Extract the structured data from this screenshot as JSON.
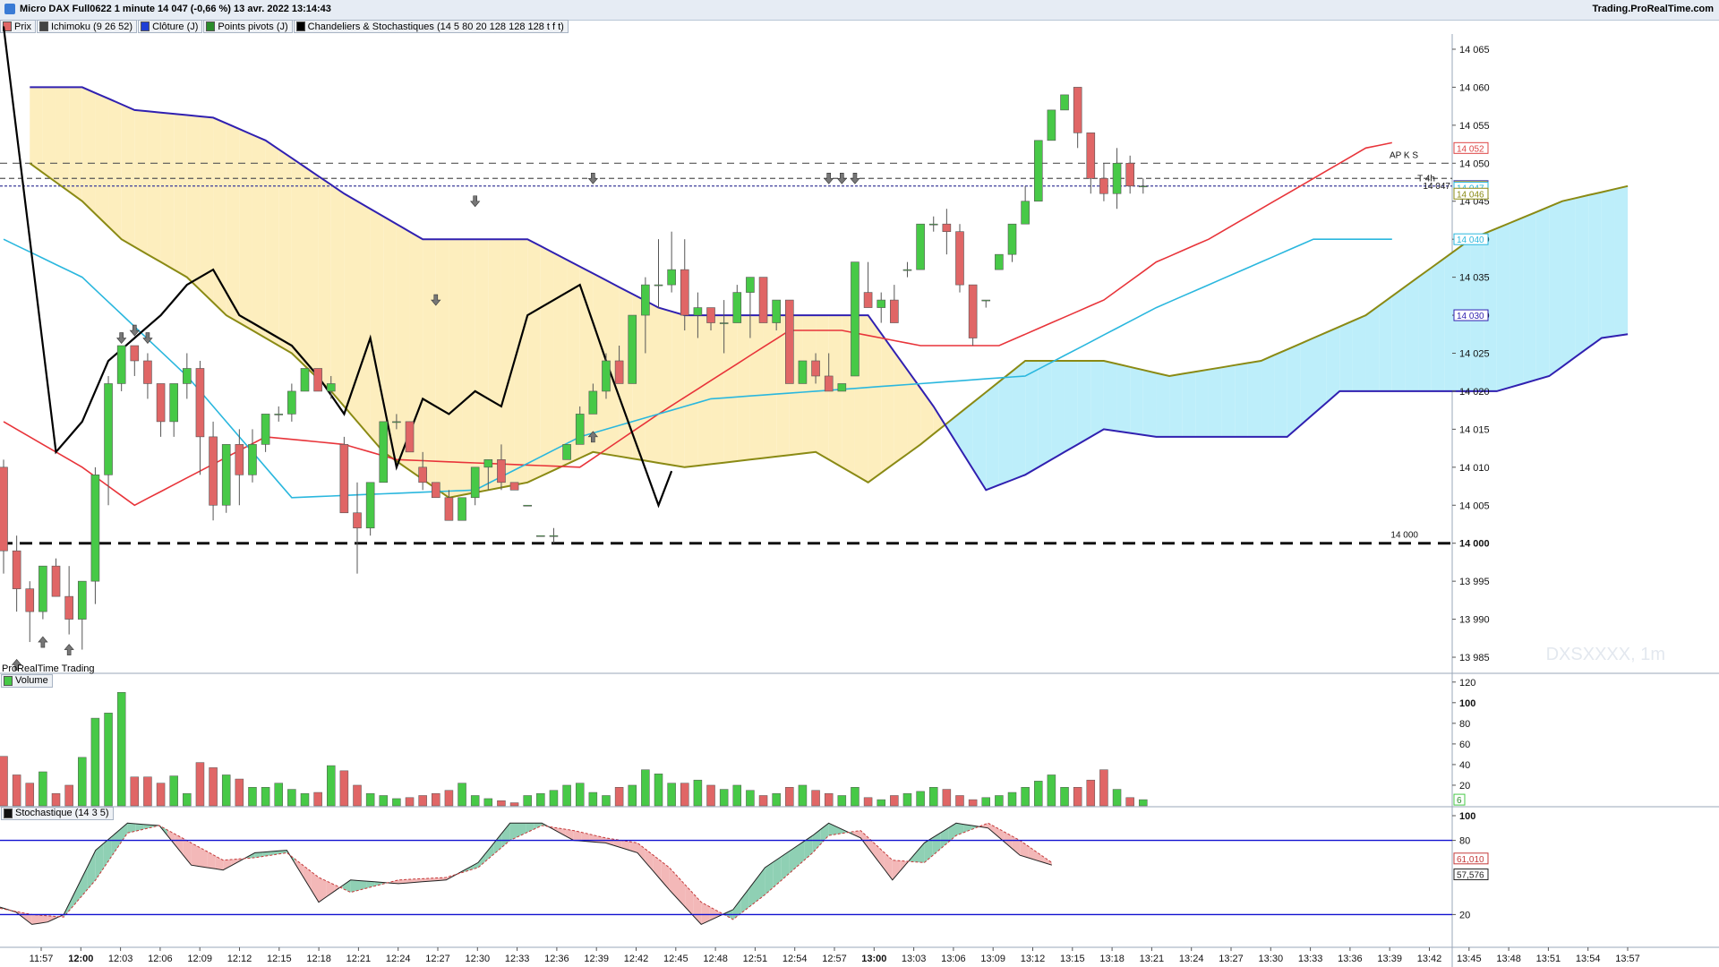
{
  "window": {
    "title": "Micro DAX Full0622 1 minute 14 047 (-0,66 %) 13 avr. 2022 13:14:43",
    "site": "Trading.ProRealTime.com"
  },
  "legend": [
    {
      "label": "Prix",
      "color": "#e06666"
    },
    {
      "label": "Ichimoku (9 26 52)",
      "color": "#444444"
    },
    {
      "label": "Clôture (J)",
      "color": "#1f3fd6"
    },
    {
      "label": "Points pivots (J)",
      "color": "#2a8c2a"
    },
    {
      "label": "Chandeliers & Stochastiques (14 5 80 20 128 128 128 t f t)",
      "color": "#000000"
    }
  ],
  "watermarks": {
    "main": "DXSXXXX, 1m",
    "brand": "ProRealTime Trading"
  },
  "panels": {
    "volume_label": "Volume",
    "stoch_label": "Stochastique (14 3 5)"
  },
  "colors": {
    "up": "#47c947",
    "down": "#e06666",
    "tenkan": "#e8343a",
    "kijun": "#2ab7de",
    "span_a": "#8a8a14",
    "span_b": "#3020b0",
    "cloud_bull": "#bdeefa",
    "cloud_bear": "#fdeebe",
    "chikou": "#000000"
  },
  "chart_data": [
    {
      "type": "candlestick",
      "name": "Prix",
      "ylim": [
        13983,
        14067
      ],
      "y_ticks": [
        "14 065",
        "14 060",
        "14 055",
        "14 050",
        "14 045",
        "14 040",
        "14 035",
        "14 030",
        "14 025",
        "14 020",
        "14 015",
        "14 010",
        "14 005",
        "14 000",
        "13 995",
        "13 990",
        "13 985"
      ],
      "x_ticks": [
        "11:57",
        "12:00",
        "12:03",
        "12:06",
        "12:09",
        "12:12",
        "12:15",
        "12:18",
        "12:21",
        "12:24",
        "12:27",
        "12:30",
        "12:33",
        "12:36",
        "12:39",
        "12:42",
        "12:45",
        "12:48",
        "12:51",
        "12:54",
        "12:57",
        "13:00",
        "13:03",
        "13:06",
        "13:09",
        "13:12",
        "13:15",
        "13:18",
        "13:21",
        "13:24",
        "13:27",
        "13:30",
        "13:33",
        "13:36",
        "13:39",
        "13:42",
        "13:45",
        "13:48",
        "13:51",
        "13:54",
        "13:57"
      ],
      "candles": [
        [
          14010,
          14011,
          13996,
          13999
        ],
        [
          13999,
          14001,
          13991,
          13994
        ],
        [
          13994,
          13995,
          13987,
          13991
        ],
        [
          13991,
          13997,
          13990,
          13997
        ],
        [
          13997,
          13998,
          13993,
          13993
        ],
        [
          13993,
          13997,
          13988,
          13990
        ],
        [
          13990,
          13995,
          13986,
          13995
        ],
        [
          13995,
          14010,
          13992,
          14009
        ],
        [
          14009,
          14022,
          14005,
          14021
        ],
        [
          14021,
          14026,
          14020,
          14026
        ],
        [
          14026,
          14026,
          14022,
          14024
        ],
        [
          14024,
          14025,
          14019,
          14021
        ],
        [
          14021,
          14021,
          14014,
          14016
        ],
        [
          14016,
          14021,
          14014,
          14021
        ],
        [
          14021,
          14025,
          14019,
          14023
        ],
        [
          14023,
          14024,
          14009,
          14014
        ],
        [
          14014,
          14016,
          14003,
          14005
        ],
        [
          14005,
          14013,
          14004,
          14013
        ],
        [
          14013,
          14015,
          14005,
          14009
        ],
        [
          14009,
          14015,
          14008,
          14013
        ],
        [
          14013,
          14017,
          14012,
          14017
        ],
        [
          14017,
          14018,
          14016,
          14017
        ],
        [
          14017,
          14021,
          14016,
          14020
        ],
        [
          14020,
          14023,
          14020,
          14023
        ],
        [
          14023,
          14023,
          14021,
          14020
        ],
        [
          14020,
          14022,
          14019,
          14021
        ],
        [
          14013,
          14014,
          14004,
          14004
        ],
        [
          14004,
          14008,
          13996,
          14002
        ],
        [
          14002,
          14006,
          14001,
          14008
        ],
        [
          14008,
          14016,
          14012,
          14016
        ],
        [
          14016,
          14017,
          14015,
          14016
        ],
        [
          14016,
          14014,
          14012,
          14012
        ],
        [
          14010,
          14012,
          14007,
          14008
        ],
        [
          14008,
          14008,
          14007,
          14006
        ],
        [
          14006,
          14007,
          14003,
          14003
        ],
        [
          14003,
          14006,
          14003,
          14006
        ],
        [
          14006,
          14010,
          14005,
          14010
        ],
        [
          14010,
          14011,
          14007,
          14011
        ],
        [
          14011,
          14013,
          14007,
          14008
        ],
        [
          14008,
          14008,
          14007,
          14007
        ],
        [
          14005,
          14005,
          14005,
          14005
        ],
        [
          14001,
          14001,
          14001,
          14001
        ],
        [
          14001,
          14002,
          14000,
          14001
        ],
        [
          14011,
          14013,
          14011,
          14013
        ],
        [
          14013,
          14018,
          14013,
          14017
        ],
        [
          14017,
          14021,
          14019,
          14020
        ],
        [
          14020,
          14025,
          14019,
          14024
        ],
        [
          14024,
          14026,
          14021,
          14021
        ],
        [
          14021,
          14030,
          14021,
          14030
        ],
        [
          14030,
          14035,
          14025,
          14034
        ],
        [
          14034,
          14040,
          14031,
          14034
        ],
        [
          14034,
          14041,
          14033,
          14036
        ],
        [
          14036,
          14040,
          14028,
          14030
        ],
        [
          14030,
          14033,
          14027,
          14031
        ],
        [
          14031,
          14031,
          14028,
          14029
        ],
        [
          14029,
          14032,
          14025,
          14029
        ],
        [
          14029,
          14034,
          14030,
          14033
        ],
        [
          14033,
          14034,
          14027,
          14035
        ],
        [
          14035,
          14035,
          14029,
          14029
        ],
        [
          14029,
          14032,
          14028,
          14032
        ],
        [
          14032,
          14032,
          14021,
          14021
        ],
        [
          14021,
          14024,
          14022,
          14024
        ],
        [
          14024,
          14025,
          14021,
          14022
        ],
        [
          14022,
          14025,
          14020,
          14020
        ],
        [
          14020,
          14021,
          14020,
          14021
        ],
        [
          14022,
          14037,
          14022,
          14037
        ],
        [
          14033,
          14037,
          14031,
          14031
        ],
        [
          14031,
          14033,
          14029,
          14032
        ],
        [
          14032,
          14034,
          14030,
          14029
        ],
        [
          14036,
          14037,
          14035,
          14036
        ],
        [
          14036,
          14040,
          14040,
          14042
        ],
        [
          14042,
          14043,
          14041,
          14042
        ],
        [
          14042,
          14044,
          14038,
          14041
        ],
        [
          14041,
          14042,
          14033,
          14034
        ],
        [
          14034,
          14033,
          14026,
          14027
        ],
        [
          14032,
          14032,
          14031,
          14032
        ],
        [
          14036,
          14036,
          14038,
          14038
        ],
        [
          14038,
          14041,
          14037,
          14042
        ],
        [
          14042,
          14047,
          14042,
          14045
        ],
        [
          14045,
          14053,
          14045,
          14053
        ],
        [
          14053,
          14057,
          14053,
          14057
        ],
        [
          14057,
          14059,
          14057,
          14059
        ],
        [
          14060,
          14060,
          14052,
          14054
        ],
        [
          14054,
          14052,
          14046,
          14048
        ],
        [
          14048,
          14050,
          14045,
          14046
        ],
        [
          14046,
          14052,
          14044,
          14050
        ],
        [
          14050,
          14051,
          14046,
          14047
        ],
        [
          14047,
          14048,
          14046,
          14047
        ]
      ],
      "ichimoku": {
        "tenkan": [],
        "kijun": [],
        "span_a": [],
        "span_b": [],
        "chikou": []
      },
      "levels": [
        {
          "label": "AP K S",
          "value": 14050
        },
        {
          "label": "T 4h",
          "value": 14048
        },
        {
          "label": "14 047",
          "value": 14047
        },
        {
          "label": "14 000",
          "value": 14000
        }
      ],
      "price_tags": [
        {
          "label": "14 052",
          "value": 14052
        },
        {
          "label": "14 050",
          "value": 14050
        },
        {
          "label": "14 047",
          "value": 14047
        },
        {
          "label": "14 047",
          "value": 14046.8
        },
        {
          "label": "14 046",
          "value": 14046
        },
        {
          "label": "14 040",
          "value": 14040
        },
        {
          "label": "14 030",
          "value": 14030
        },
        {
          "label": "14 000",
          "value": 14000
        }
      ]
    },
    {
      "type": "bar",
      "name": "Volume",
      "ylim": [
        0,
        125
      ],
      "y_ticks": [
        "120",
        "100",
        "80",
        "60",
        "40",
        "20"
      ],
      "values": [
        48,
        30,
        22,
        33,
        12,
        20,
        47,
        85,
        90,
        110,
        28,
        28,
        22,
        29,
        12,
        42,
        37,
        30,
        26,
        18,
        18,
        22,
        16,
        12,
        13,
        39,
        34,
        20,
        12,
        10,
        7,
        8,
        10,
        12,
        15,
        22,
        10,
        7,
        5,
        3,
        10,
        12,
        15,
        20,
        22,
        13,
        10,
        18,
        20,
        35,
        31,
        22,
        22,
        25,
        20,
        16,
        20,
        15,
        10,
        12,
        18,
        20,
        15,
        12,
        10,
        18,
        8,
        6,
        10,
        12,
        14,
        18,
        16,
        10,
        6,
        8,
        10,
        13,
        18,
        24,
        30,
        18,
        18,
        25,
        35,
        16,
        8,
        6
      ],
      "tags": [
        {
          "label": "6",
          "value": 6
        }
      ]
    },
    {
      "type": "line",
      "name": "Stochastique (14 3 5)",
      "ylim": [
        0,
        100
      ],
      "y_ticks": [
        "100",
        "80",
        "20"
      ],
      "levels": [
        80,
        20
      ],
      "k": [],
      "d": [],
      "tags": [
        {
          "label": "61,010",
          "value": 61.01
        },
        {
          "label": "57,576",
          "value": 57.576
        }
      ]
    }
  ]
}
